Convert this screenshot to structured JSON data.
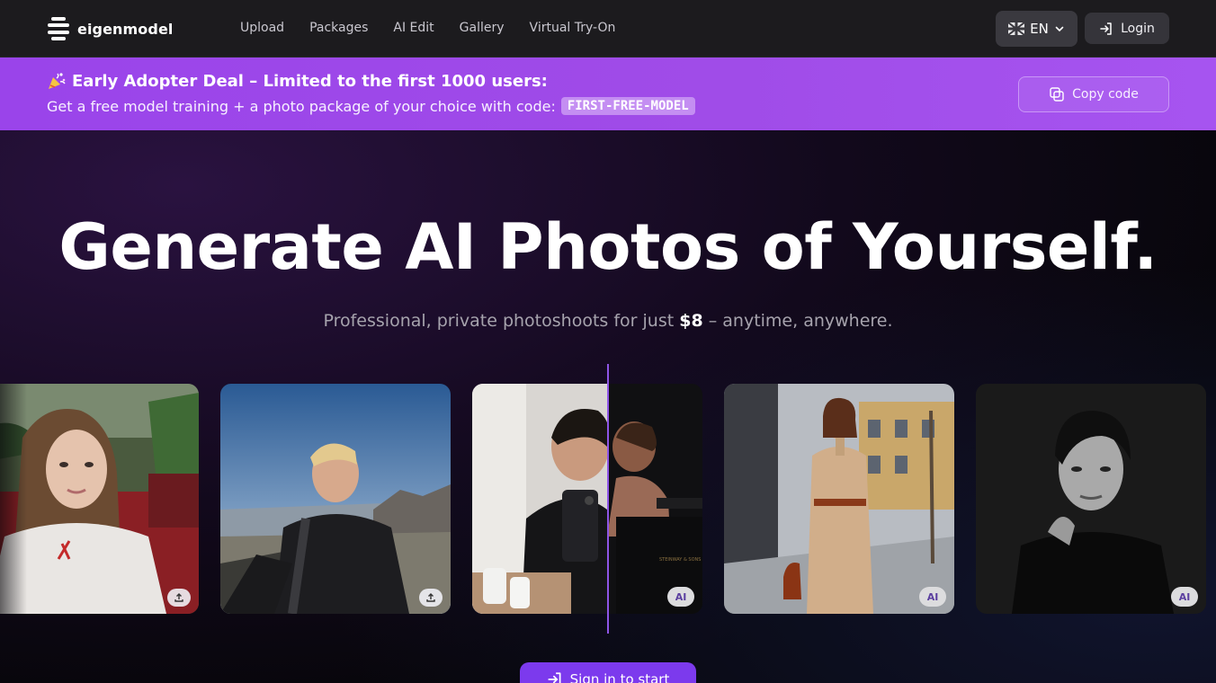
{
  "brand": {
    "name": "eigenmodel"
  },
  "nav": {
    "links": [
      "Upload",
      "Packages",
      "AI Edit",
      "Gallery",
      "Virtual Try-On"
    ],
    "language": "EN",
    "login_label": "Login"
  },
  "promo": {
    "title": "Early Adopter Deal – Limited to the first 1000 users:",
    "subtitle": "Get a free model training + a photo package of your choice with code:",
    "code": "FIRST-FREE-MODEL",
    "copy_label": "Copy code"
  },
  "hero": {
    "headline": "Generate AI Photos of Yourself.",
    "sub_prefix": "Professional, private photoshoots for just",
    "price": "$8",
    "sub_suffix": "– anytime, anywhere.",
    "cta_label": "Sign in to start"
  },
  "gallery": {
    "ai_badge": "AI",
    "watermark_text": "STEINWAY & SONS"
  },
  "colors": {
    "accent": "#7c3aed",
    "promo_bg": "#a04ce8",
    "nav_bg": "#1c1b1e"
  }
}
